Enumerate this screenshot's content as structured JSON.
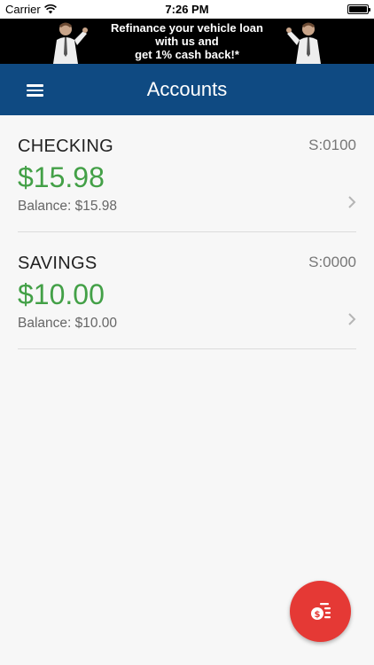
{
  "status_bar": {
    "carrier": "Carrier",
    "time": "7:26 PM",
    "battery_level": 1.0
  },
  "ad": {
    "line1": "Refinance your vehicle loan",
    "line2": "with us and",
    "line3": "get 1% cash back!*"
  },
  "header": {
    "title": "Accounts",
    "menu_icon": "hamburger-menu-icon"
  },
  "accounts": [
    {
      "name": "CHECKING",
      "suffix": "S:0100",
      "amount": "$15.98",
      "balance": "Balance: $15.98"
    },
    {
      "name": "SAVINGS",
      "suffix": "S:0000",
      "amount": "$10.00",
      "balance": "Balance: $10.00"
    }
  ],
  "fab": {
    "icon": "transfer-money-icon"
  },
  "colors": {
    "header": "#0f4a82",
    "amount": "#43a047",
    "fab": "#e53935"
  }
}
